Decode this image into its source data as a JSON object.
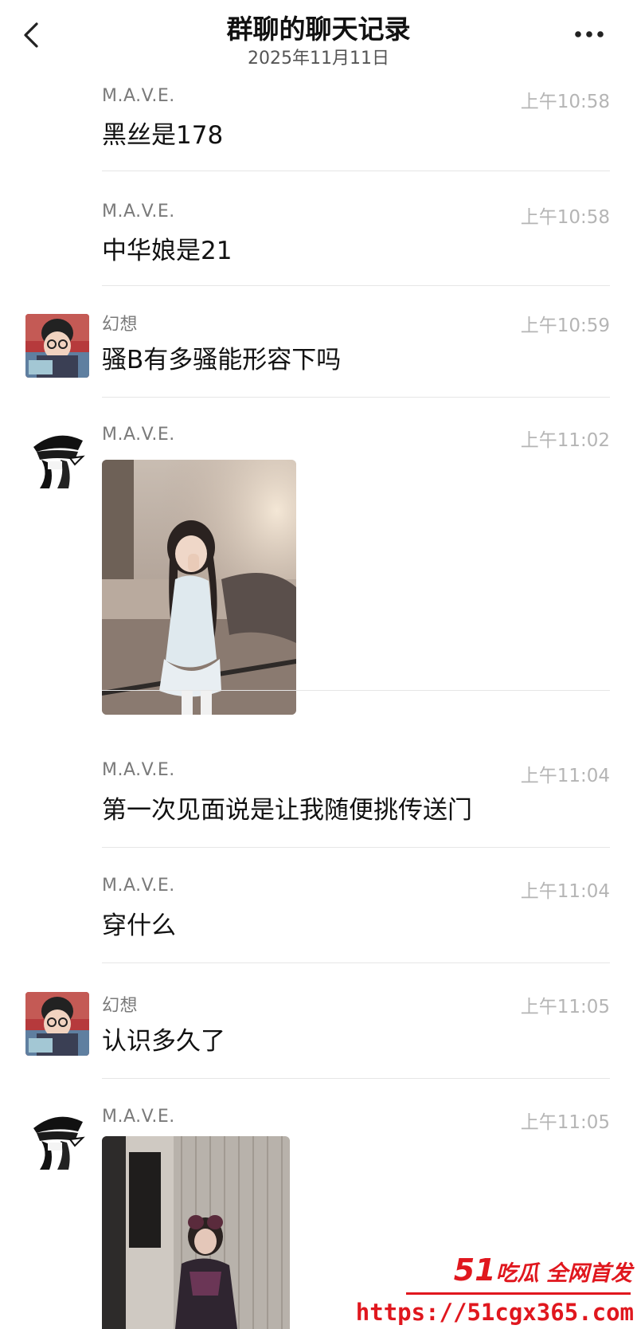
{
  "header": {
    "title": "群聊的聊天记录",
    "subtitle": "2025年11月11日",
    "back_icon": "chevron-left-icon",
    "more_icon": "more-horizontal-icon"
  },
  "messages": [
    {
      "sender": "M.A.V.E.",
      "time": "上午10:58",
      "text": "黑丝是178"
    },
    {
      "sender": "M.A.V.E.",
      "time": "上午10:58",
      "text": "中华娘是21"
    },
    {
      "sender": "幻想",
      "time": "上午10:59",
      "text": "骚B有多骚能形容下吗"
    },
    {
      "sender": "M.A.V.E.",
      "time": "上午11:02",
      "type": "image"
    },
    {
      "sender": "M.A.V.E.",
      "time": "上午11:04",
      "text": "第一次见面说是让我随便挑传送门"
    },
    {
      "sender": "M.A.V.E.",
      "time": "上午11:04",
      "text": "穿什么"
    },
    {
      "sender": "幻想",
      "time": "上午11:05",
      "text": "认识多久了"
    },
    {
      "sender": "M.A.V.E.",
      "time": "上午11:05",
      "type": "image"
    }
  ],
  "watermark": {
    "brand_number": "51",
    "brand_text": "吃瓜 全网首发",
    "url": "https://51cgx365.com"
  },
  "colors": {
    "accent": "#e0171e",
    "timestamp": "#b5b5b5",
    "sender": "#7a7a7a"
  }
}
